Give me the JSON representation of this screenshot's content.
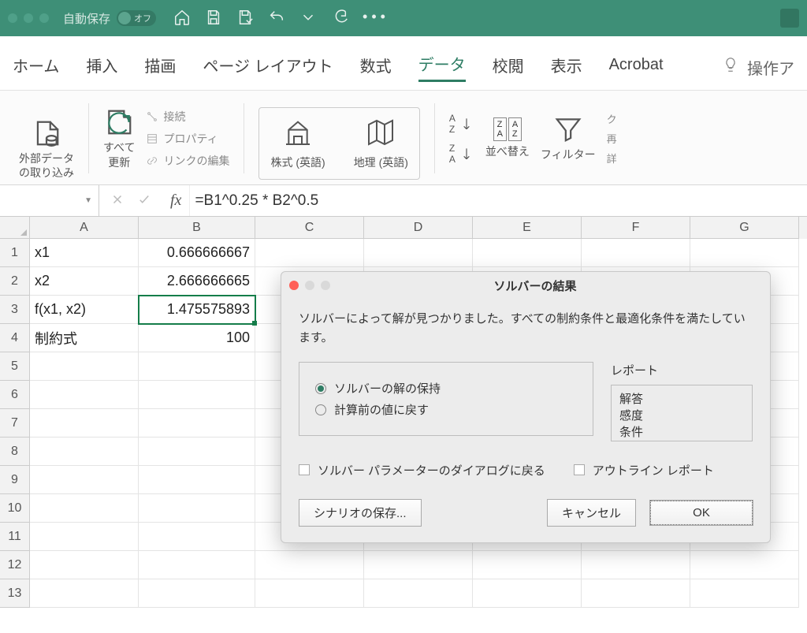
{
  "titlebar": {
    "autosave_label": "自動保存",
    "autosave_state": "オフ"
  },
  "tabs": {
    "home": "ホーム",
    "insert": "挿入",
    "draw": "描画",
    "pagelayout": "ページ レイアウト",
    "formulas": "数式",
    "data": "データ",
    "review": "校閲",
    "view": "表示",
    "acrobat": "Acrobat",
    "help": "操作ア"
  },
  "ribbon": {
    "external_data": "外部データ\nの取り込み",
    "refresh_all": "すべて\n更新",
    "connections": "接続",
    "properties": "プロパティ",
    "edit_links": "リンクの編集",
    "stocks": "株式 (英語)",
    "geo": "地理 (英語)",
    "sort": "並べ替え",
    "filter": "フィルター",
    "clear": "ク",
    "reapply": "再",
    "advanced": "詳"
  },
  "formula_bar": {
    "formula": "=B1^0.25 * B2^0.5"
  },
  "columns": [
    "A",
    "B",
    "C",
    "D",
    "E",
    "F",
    "G"
  ],
  "rows": [
    {
      "n": "1",
      "A": "x1",
      "B": "0.666666667"
    },
    {
      "n": "2",
      "A": "x2",
      "B": "2.666666665"
    },
    {
      "n": "3",
      "A": "f(x1, x2)",
      "B": "1.475575893",
      "selected": true
    },
    {
      "n": "4",
      "A": "制約式",
      "B": "100"
    },
    {
      "n": "5"
    },
    {
      "n": "6"
    },
    {
      "n": "7"
    },
    {
      "n": "8"
    },
    {
      "n": "9"
    },
    {
      "n": "10"
    },
    {
      "n": "11"
    },
    {
      "n": "12"
    },
    {
      "n": "13"
    }
  ],
  "dialog": {
    "title": "ソルバーの結果",
    "message": "ソルバーによって解が見つかりました。すべての制約条件と最適化条件を満たしています。",
    "radio_keep": "ソルバーの解の保持",
    "radio_revert": "計算前の値に戻す",
    "report_label": "レポート",
    "reports": {
      "answer": "解答",
      "sensitivity": "感度",
      "limits": "条件"
    },
    "chk_return": "ソルバー パラメーターのダイアログに戻る",
    "chk_outline": "アウトライン レポート",
    "btn_scenario": "シナリオの保存...",
    "btn_cancel": "キャンセル",
    "btn_ok": "OK"
  }
}
